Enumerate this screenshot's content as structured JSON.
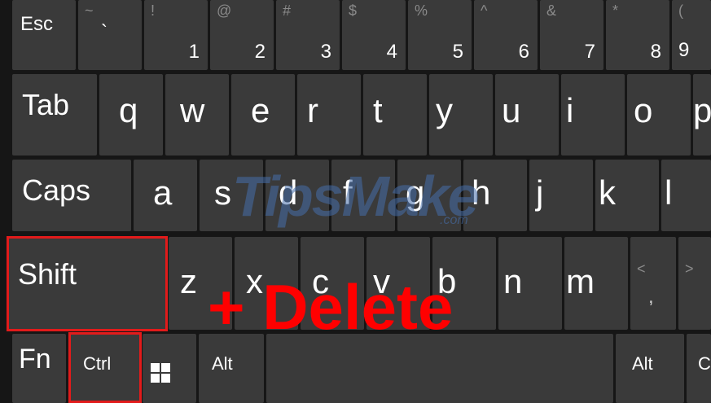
{
  "row1": [
    {
      "name": "esc",
      "label": "Esc"
    },
    {
      "name": "backtick",
      "symbol": "~",
      "label": "`"
    },
    {
      "name": "1",
      "symbol": "!",
      "label": "1"
    },
    {
      "name": "2",
      "symbol": "@",
      "label": "2"
    },
    {
      "name": "3",
      "symbol": "#",
      "label": "3"
    },
    {
      "name": "4",
      "symbol": "$",
      "label": "4"
    },
    {
      "name": "5",
      "symbol": "%",
      "label": "5"
    },
    {
      "name": "6",
      "symbol": "^",
      "label": "6"
    },
    {
      "name": "7",
      "symbol": "&",
      "label": "7"
    },
    {
      "name": "8",
      "symbol": "*",
      "label": "8"
    },
    {
      "name": "9",
      "symbol": "(",
      "label": "9"
    }
  ],
  "row2": [
    "Tab",
    "q",
    "w",
    "e",
    "r",
    "t",
    "y",
    "u",
    "i",
    "o",
    "p"
  ],
  "row3": [
    "Caps",
    "a",
    "s",
    "d",
    "f",
    "g",
    "h",
    "j",
    "k",
    "l"
  ],
  "row4": {
    "shift": "Shift",
    "letters": [
      "z",
      "x",
      "c",
      "v",
      "b",
      "n",
      "m"
    ],
    "comma_symbol": "<",
    "comma": ",",
    "period_symbol": ">"
  },
  "row5": {
    "fn": "Fn",
    "ctrl": "Ctrl",
    "win_icon": "windows-logo",
    "alt": "Alt",
    "alt_right": "Alt",
    "ctrl_right_partial": "C"
  },
  "overlay_text": "+ Delete",
  "watermark": "TipsMake",
  "watermark_suffix": ".com",
  "colors": {
    "key": "#3a3a3a",
    "background": "#161616",
    "highlight": "#e21b1b",
    "overlay": "#ff0000"
  }
}
